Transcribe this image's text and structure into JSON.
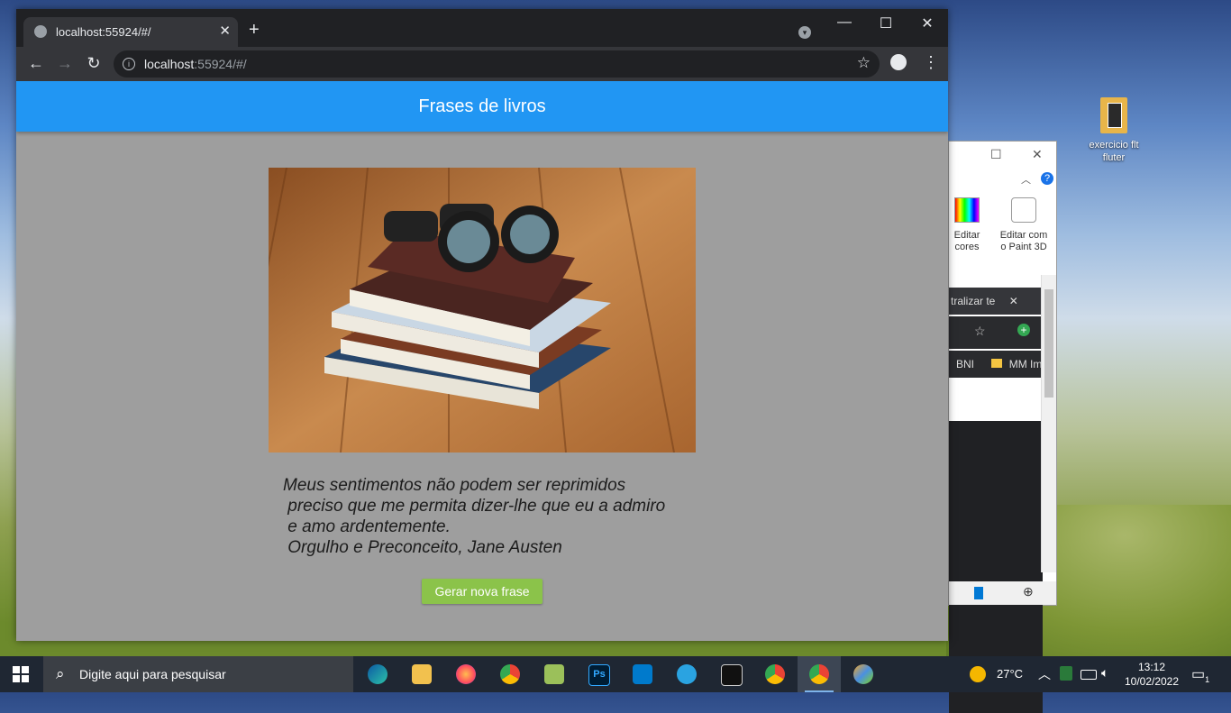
{
  "browser": {
    "tab_title": "localhost:55924/#/",
    "url_host": "localhost",
    "url_path": ":55924/#/"
  },
  "app": {
    "title": "Frases de livros",
    "quote": "Meus sentimentos não podem ser reprimidos\n preciso que me permita dizer-lhe que eu a admiro\n e amo ardentemente.\n Orgulho e Preconceito, Jane Austen",
    "button_label": "Gerar nova frase",
    "colors": {
      "appbar": "#2196f3",
      "button": "#8bc34a",
      "background": "#9e9e9e"
    }
  },
  "paint_window": {
    "edit_colors": "Editar\ncores",
    "edit_paint3d": "Editar com\no Paint 3D",
    "tab_text": "tralizar te",
    "bookmark_1": "BNI",
    "bookmark_2": "MM Im"
  },
  "desktop": {
    "icon_label": "exercicio flt fluter"
  },
  "taskbar": {
    "search_placeholder": "Digite aqui para pesquisar",
    "temperature": "27°C",
    "time": "13:12",
    "date": "10/02/2022",
    "notification_count": "1",
    "apps": [
      "edge",
      "file-explorer",
      "firefox",
      "chrome",
      "notepad",
      "photoshop",
      "vscode",
      "telegram",
      "terminal",
      "chrome",
      "chrome",
      "paint"
    ]
  }
}
